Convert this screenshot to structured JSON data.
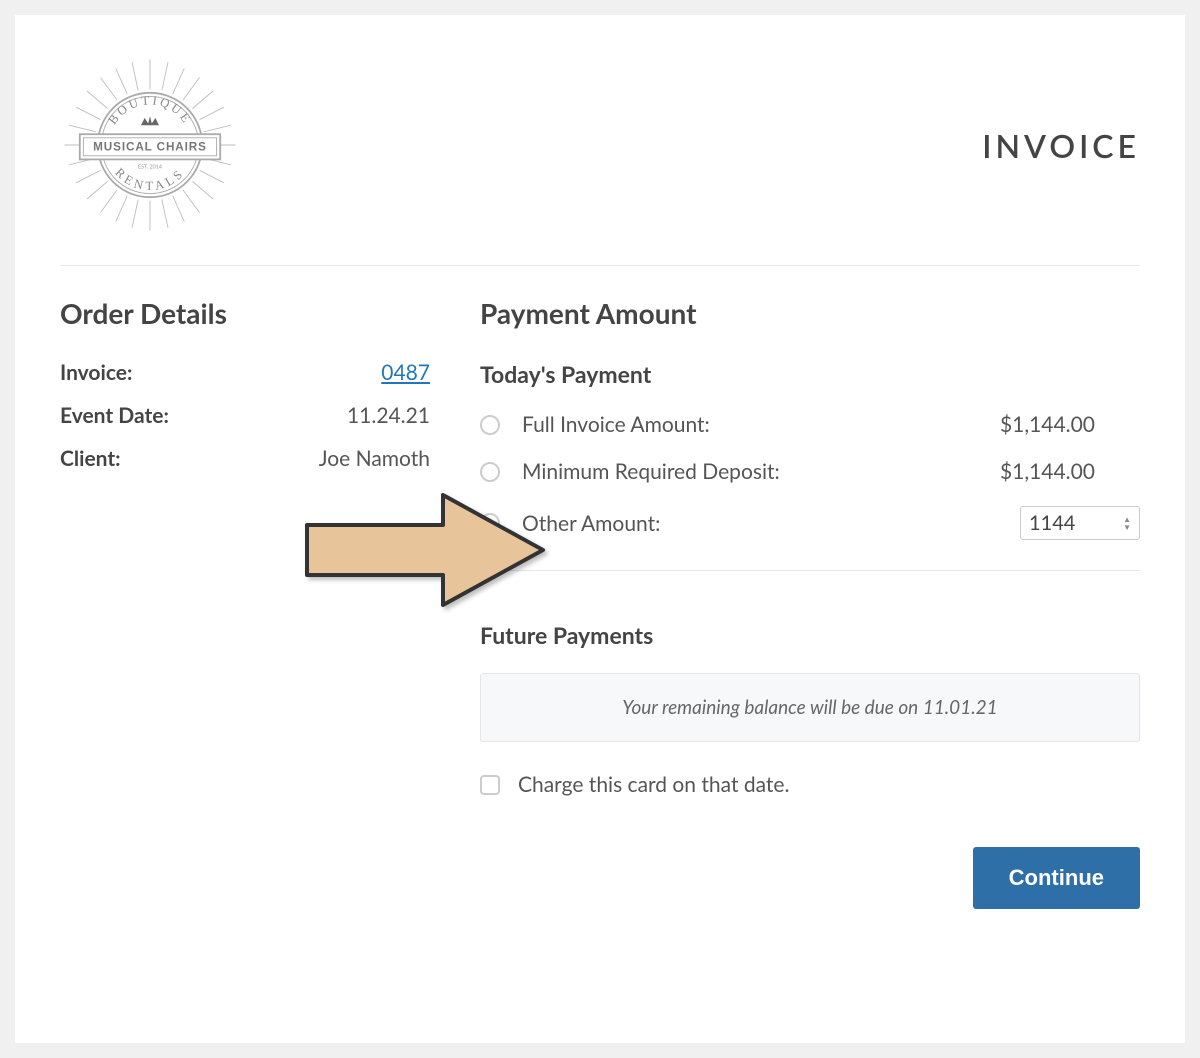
{
  "header": {
    "logo_text_top": "BOUTIQUE",
    "logo_text_main": "MUSICAL CHAIRS",
    "logo_text_est": "EST. 2014",
    "logo_text_bottom": "RENTALS",
    "title": "INVOICE"
  },
  "order_details": {
    "heading": "Order Details",
    "invoice_label": "Invoice:",
    "invoice_value": "0487",
    "event_date_label": "Event Date:",
    "event_date_value": "11.24.21",
    "client_label": "Client:",
    "client_value": "Joe Namoth"
  },
  "payment": {
    "heading": "Payment Amount",
    "today_heading": "Today's Payment",
    "options": [
      {
        "label": "Full Invoice Amount:",
        "value": "$1,144.00"
      },
      {
        "label": "Minimum Required Deposit:",
        "value": "$1,144.00"
      },
      {
        "label": "Other Amount:"
      }
    ],
    "other_amount_input": "1144",
    "future_heading": "Future Payments",
    "future_text": "Your remaining balance will be due on 11.01.21",
    "charge_checkbox_label": "Charge this card on that date.",
    "continue_label": "Continue"
  }
}
